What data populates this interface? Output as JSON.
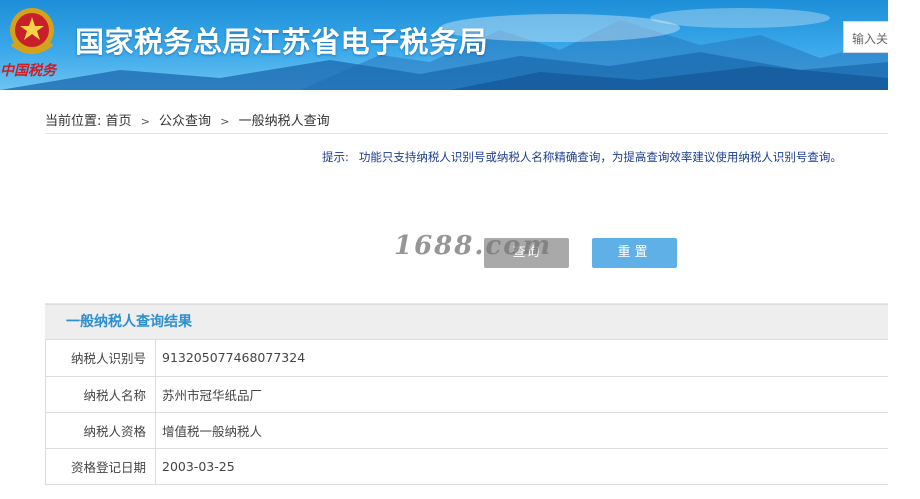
{
  "header": {
    "title": "国家税务总局江苏省电子税务局",
    "emblem_caption": "中国税务",
    "search_placeholder": "输入关"
  },
  "breadcrumb": {
    "prefix": "当前位置:",
    "items": [
      "首页",
      "公众查询",
      "一般纳税人查询"
    ]
  },
  "query": {
    "tip_label": "提示:",
    "tip_text": "功能只支持纳税人识别号或纳税人名称精确查询，为提高查询效率建议使用纳税人识别号查询。",
    "query_button": "查询",
    "reset_button": "重置",
    "watermark": "1688.com"
  },
  "results": {
    "title": "一般纳税人查询结果",
    "rows": [
      {
        "label": "纳税人识别号",
        "value": "913205077468077324"
      },
      {
        "label": "纳税人名称",
        "value": "苏州市冠华纸品厂"
      },
      {
        "label": "纳税人资格",
        "value": "增值税一般纳税人"
      },
      {
        "label": "资格登记日期",
        "value": "2003-03-25"
      }
    ]
  },
  "colors": {
    "banner": "#1d8fd8",
    "accent": "#2e8fcf",
    "reset_button": "#5fb0e6",
    "query_button": "#a9a9a9",
    "tip_text": "#1a3d8f"
  }
}
